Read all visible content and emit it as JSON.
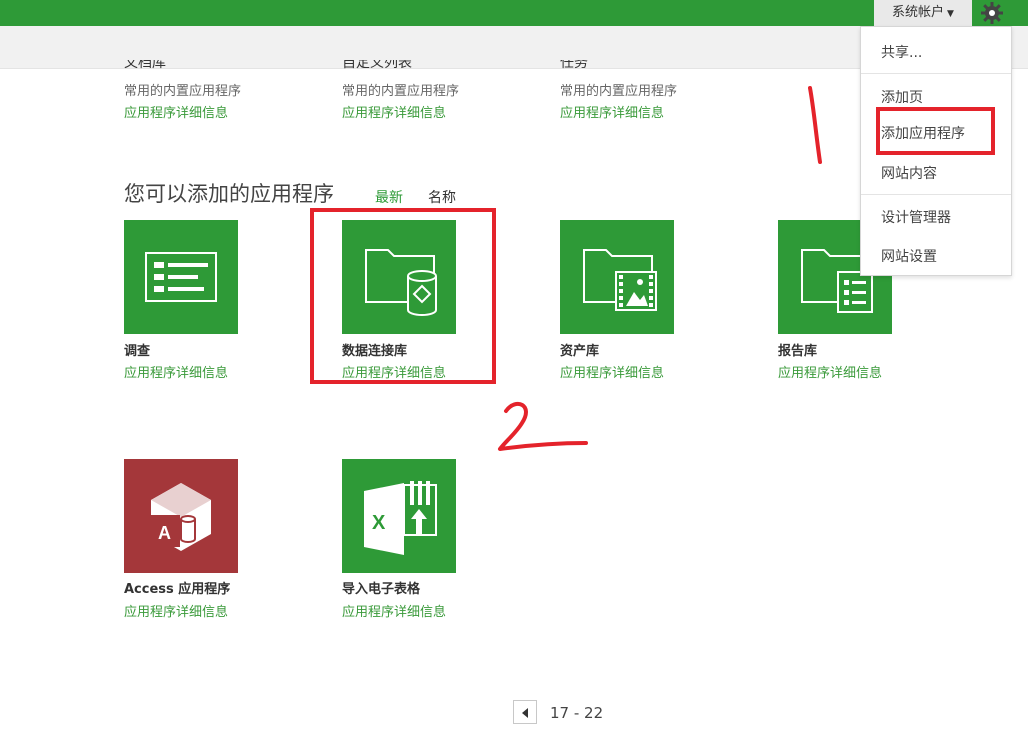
{
  "header": {
    "account_label": "系统帐户",
    "settings_icon": "gear-icon"
  },
  "top_row": [
    {
      "title": "文档库",
      "desc": "常用的内置应用程序",
      "link": "应用程序详细信息"
    },
    {
      "title": "自定义列表",
      "desc": "常用的内置应用程序",
      "link": "应用程序详细信息"
    },
    {
      "title": "任务",
      "desc": "常用的内置应用程序",
      "link": "应用程序详细信息"
    }
  ],
  "section": {
    "heading": "您可以添加的应用程序",
    "sort_newest": "最新",
    "sort_name": "名称"
  },
  "apps": [
    {
      "name": "调查",
      "link": "应用程序详细信息",
      "icon": "survey-icon"
    },
    {
      "name": "数据连接库",
      "link": "应用程序详细信息",
      "icon": "data-connection-library-icon"
    },
    {
      "name": "资产库",
      "link": "应用程序详细信息",
      "icon": "asset-library-icon"
    },
    {
      "name": "报告库",
      "link": "应用程序详细信息",
      "icon": "report-library-icon"
    },
    {
      "name": "Access 应用程序",
      "link": "应用程序详细信息",
      "icon": "access-app-icon"
    },
    {
      "name": "导入电子表格",
      "link": "应用程序详细信息",
      "icon": "import-spreadsheet-icon"
    }
  ],
  "menu": {
    "items": [
      "共享...",
      "添加页",
      "添加应用程序",
      "网站内容",
      "设计管理器",
      "网站设置"
    ]
  },
  "pager": {
    "range": "17 - 22"
  },
  "colors": {
    "brand_green": "#2e9a37",
    "access_red": "#a4373a",
    "annotation_red": "#e4232b"
  }
}
